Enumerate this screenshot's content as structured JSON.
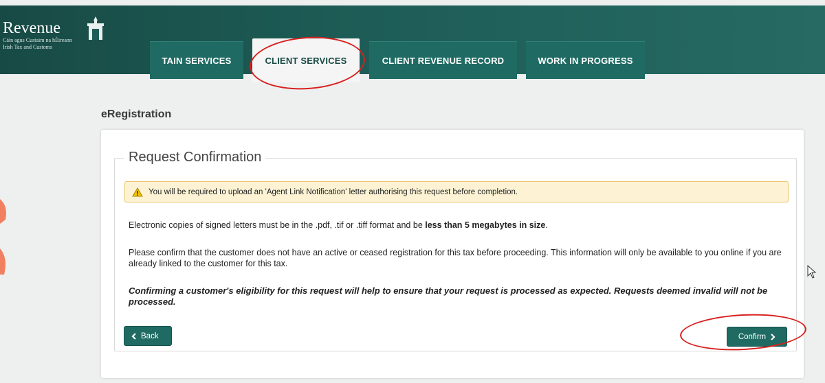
{
  "header": {
    "logo": {
      "name": "Revenue",
      "subtitle_ga": "Cáin agus Custaim na hÉireann",
      "subtitle_en": "Irish Tax and Customs"
    },
    "tabs": [
      {
        "label": "TAIN SERVICES",
        "active": false
      },
      {
        "label": "CLIENT SERVICES",
        "active": true
      },
      {
        "label": "CLIENT REVENUE RECORD",
        "active": false
      },
      {
        "label": "WORK IN PROGRESS",
        "active": false
      }
    ]
  },
  "page": {
    "title": "eRegistration",
    "section_title": "Request Confirmation",
    "warning": "You will be required to upload an 'Agent Link Notification' letter authorising this request before completion.",
    "para1_prefix": "Electronic copies of signed letters must be in the .pdf, .tif or .tiff format and be ",
    "para1_bold": "less than 5 megabytes in size",
    "para1_suffix": ".",
    "para2": "Please confirm that the customer does not have an active or ceased registration for this tax before proceeding. This information will only be available to you online if you are already linked to the customer for this tax.",
    "para3": "Confirming a customer's eligibility for this request will help to ensure that your request is processed as expected. Requests deemed invalid will not be processed.",
    "back_label": "Back",
    "confirm_label": "Confirm"
  },
  "colors": {
    "header": "#1e5d57",
    "tab": "#1f6b63",
    "button": "#1f6b63",
    "warning_bg": "#fdf3d4",
    "warning_border": "#e8c66b",
    "annotation": "#d8201e"
  },
  "icons": [
    "warning-icon",
    "chevron-left-icon",
    "chevron-right-icon",
    "revenue-crest-icon",
    "mouse-cursor-icon"
  ]
}
